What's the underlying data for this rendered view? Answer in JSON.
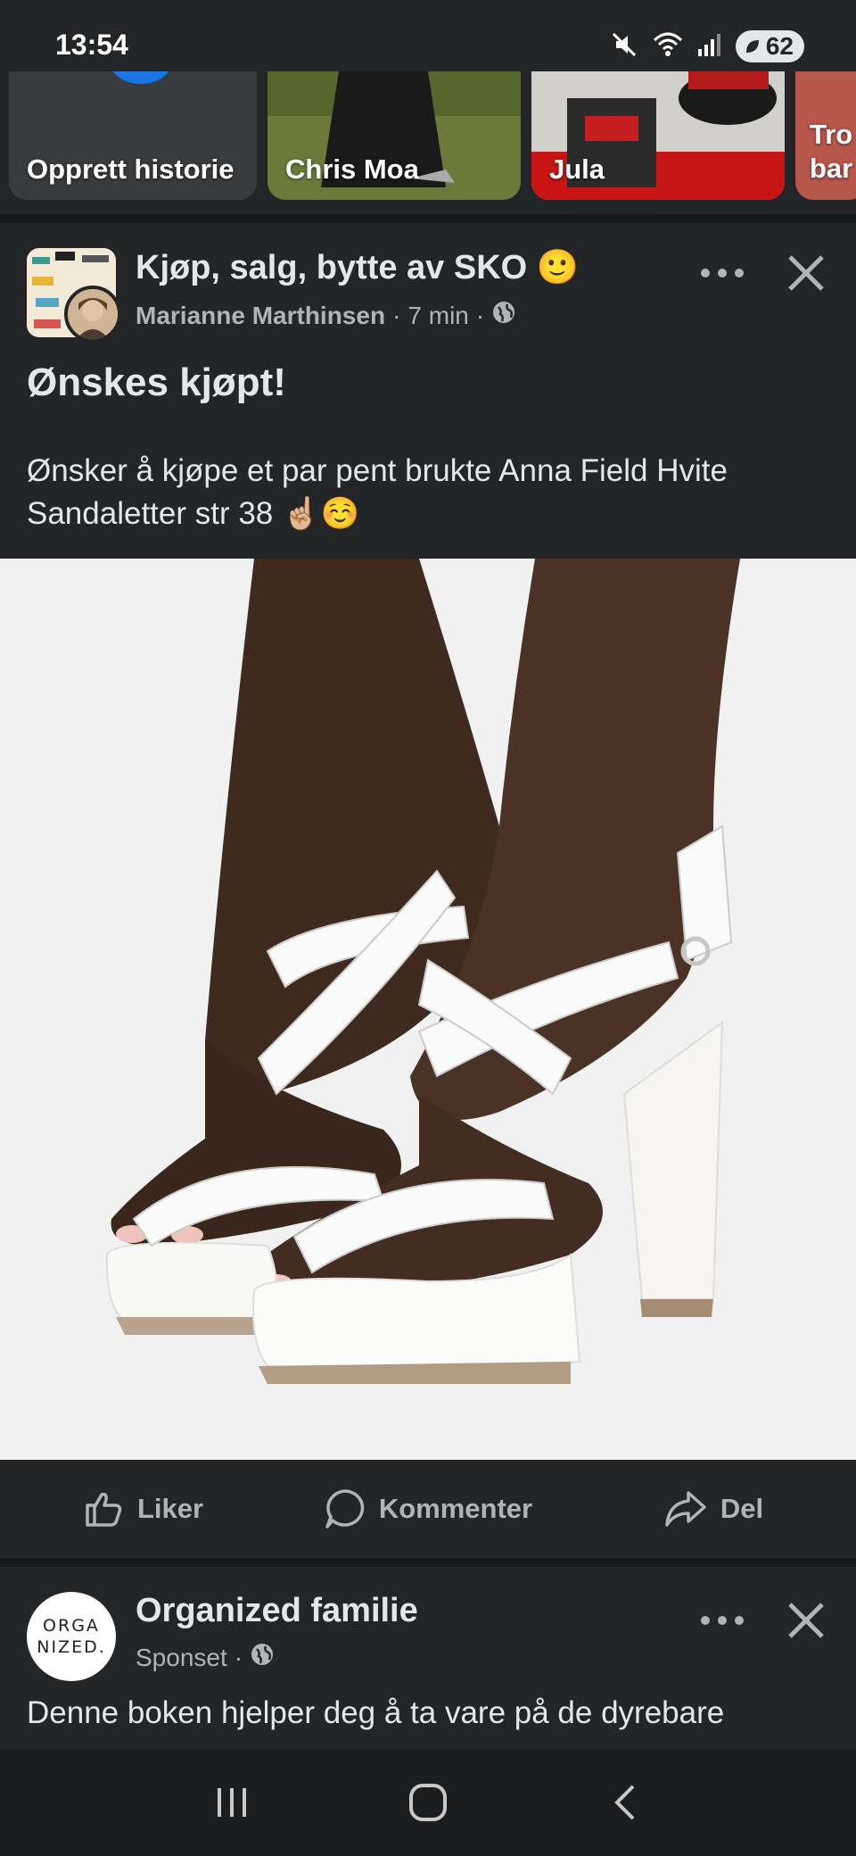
{
  "status_bar": {
    "time": "13:54",
    "battery_level": "62",
    "icons": [
      "mute-icon",
      "wifi-icon",
      "signal-icon",
      "battery-icon"
    ]
  },
  "stories": [
    {
      "label": "Opprett historie"
    },
    {
      "label": "Chris Moa"
    },
    {
      "label": "Jula"
    },
    {
      "label": "Tro bar"
    }
  ],
  "post": {
    "group_name": "Kjøp, salg, bytte av SKO 🙂",
    "author": "Marianne Marthinsen",
    "time_ago": "7 min",
    "separator": "·",
    "title": "Ønskes kjøpt!",
    "body": "Ønsker å kjøpe et par pent brukte Anna Field Hvite Sandaletter str 38 ☝🏼☺️",
    "image_description_icon": "white-sandals-photo"
  },
  "actions": {
    "like": "Liker",
    "comment": "Kommenter",
    "share": "Del"
  },
  "sponsored_post": {
    "name": "Organized familie",
    "sponsored_label": "Sponset",
    "separator": "·",
    "avatar_text": "ORGA NIZED.",
    "body": "Denne boken hjelper deg å ta vare på de dyrebare"
  },
  "colors": {
    "background": "#242526",
    "divider": "#18191a",
    "primary_text": "#e4e6eb",
    "secondary_text": "#b0b3b8",
    "accent_blue": "#1b74e4"
  }
}
